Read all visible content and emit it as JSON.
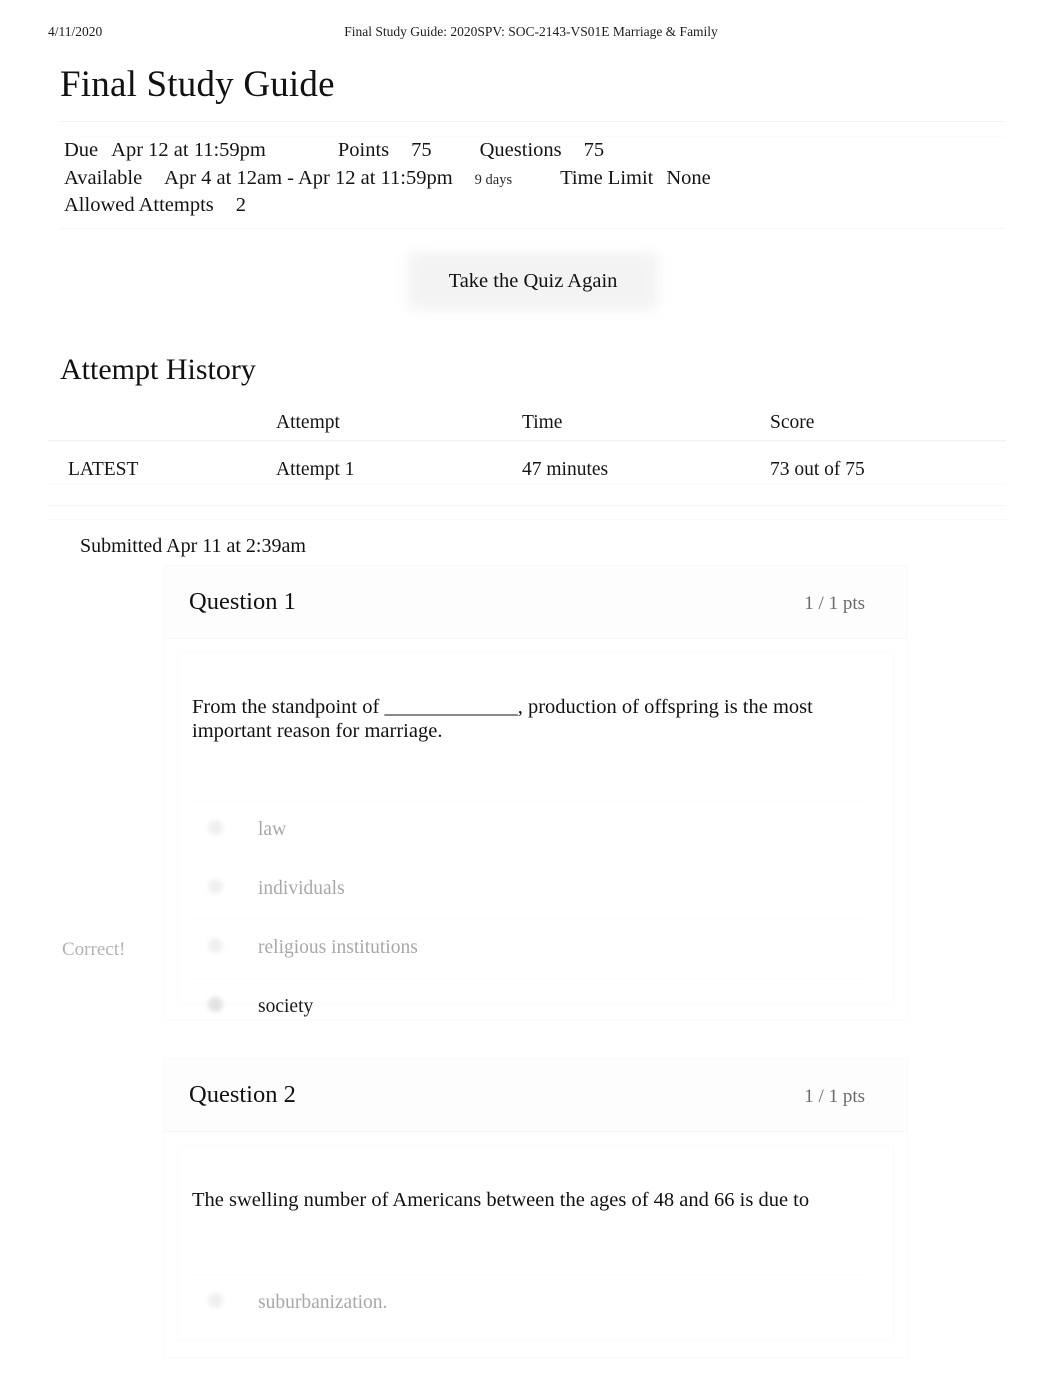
{
  "print_header": {
    "date": "4/11/2020",
    "title": "Final Study Guide: 2020SPV: SOC-2143-VS01E Marriage & Family"
  },
  "page": {
    "title": "Final Study Guide"
  },
  "quiz_meta": {
    "due_label": "Due",
    "due_value": "Apr 12 at 11:59pm",
    "points_label": "Points",
    "points_value": "75",
    "questions_label": "Questions",
    "questions_value": "75",
    "available_label": "Available",
    "available_value": "Apr 4 at 12am - Apr 12 at 11:59pm",
    "available_duration": "9 days",
    "time_limit_label": "Time Limit",
    "time_limit_value": "None",
    "allowed_attempts_label": "Allowed Attempts",
    "allowed_attempts_value": "2"
  },
  "actions": {
    "take_quiz_again": "Take the Quiz Again"
  },
  "attempt_history": {
    "heading": "Attempt History",
    "columns": {
      "blank": "",
      "attempt": "Attempt",
      "time": "Time",
      "score": "Score"
    },
    "rows": [
      {
        "flag": "LATEST",
        "attempt": "Attempt 1",
        "time": "47 minutes",
        "score": "73 out of 75"
      }
    ],
    "submitted": "Submitted Apr 11 at 2:39am"
  },
  "questions": [
    {
      "name": "Question 1",
      "points": "1 / 1 pts",
      "text": "From the standpoint of _____________, production of offspring is the most important reason for marriage.",
      "answers": [
        {
          "label": "law",
          "selected": false,
          "flag": ""
        },
        {
          "label": "individuals",
          "selected": false,
          "flag": ""
        },
        {
          "label": "religious institutions",
          "selected": false,
          "flag": ""
        },
        {
          "label": "society",
          "selected": true,
          "flag": "Correct!"
        }
      ]
    },
    {
      "name": "Question 2",
      "points": "1 / 1 pts",
      "text": "The swelling number of Americans between the ages of 48 and 66 is due to",
      "answers": [
        {
          "label": "suburbanization.",
          "selected": false,
          "flag": ""
        }
      ]
    }
  ],
  "colors": {
    "text": "#111111",
    "muted": "#a8a8a8",
    "rule": "#f4f4f4"
  }
}
